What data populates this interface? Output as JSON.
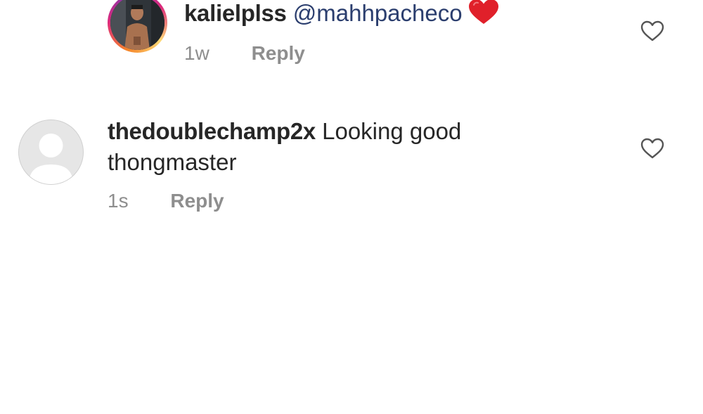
{
  "comments": [
    {
      "username": "kalielplss",
      "mention": "@mahhpacheco",
      "emoji": "heart",
      "time": "1w",
      "reply_label": "Reply",
      "avatar_type": "photo-with-story-ring"
    },
    {
      "username": "thedoublechamp2x",
      "text_line1": "Looking good",
      "text_line2": "thongmaster",
      "time": "1s",
      "reply_label": "Reply",
      "avatar_type": "default"
    }
  ],
  "colors": {
    "username": "#262626",
    "mention": "#2b3e6e",
    "meta": "#8e8e8e",
    "heart_emoji": "#e0202a",
    "like_outline": "#555555"
  },
  "icons": [
    "heart-emoji-icon",
    "like-heart-icon"
  ]
}
